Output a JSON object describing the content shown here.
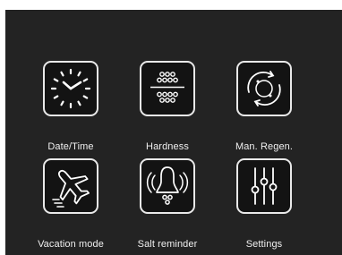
{
  "menu": {
    "items": [
      {
        "id": "date-time",
        "label": "Date/Time",
        "icon": "clock-icon"
      },
      {
        "id": "hardness",
        "label": "Hardness",
        "icon": "water-hardness-icon"
      },
      {
        "id": "man-regen",
        "label": "Man. Regen.",
        "icon": "regeneration-cycle-icon"
      },
      {
        "id": "vacation-mode",
        "label": "Vacation mode",
        "icon": "airplane-icon"
      },
      {
        "id": "salt-reminder",
        "label": "Salt reminder",
        "icon": "bell-reminder-icon"
      },
      {
        "id": "settings",
        "label": "Settings",
        "icon": "sliders-icon"
      }
    ]
  },
  "colors": {
    "background": "#232323",
    "tile_fill": "#131313",
    "tile_border": "#e9e9e9",
    "label_text": "#f0f0f0"
  }
}
